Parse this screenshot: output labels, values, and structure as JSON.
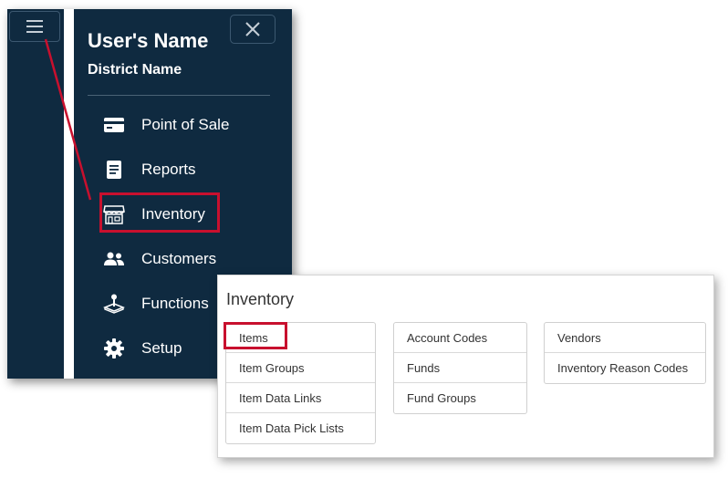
{
  "user": {
    "name": "User's Name",
    "district": "District Name"
  },
  "nav": {
    "items": [
      {
        "label": "Point of Sale",
        "icon": "credit-card-icon"
      },
      {
        "label": "Reports",
        "icon": "document-icon"
      },
      {
        "label": "Inventory",
        "icon": "storefront-icon"
      },
      {
        "label": "Customers",
        "icon": "users-icon"
      },
      {
        "label": "Functions",
        "icon": "joystick-icon"
      },
      {
        "label": "Setup",
        "icon": "gear-icon"
      }
    ]
  },
  "inventory": {
    "title": "Inventory",
    "columns": [
      [
        "Items",
        "Item Groups",
        "Item Data Links",
        "Item Data Pick Lists"
      ],
      [
        "Account Codes",
        "Funds",
        "Fund Groups"
      ],
      [
        "Vendors",
        "Inventory Reason Codes"
      ]
    ]
  },
  "colors": {
    "nav_bg": "#0f2a40",
    "highlight": "#c8102e"
  }
}
